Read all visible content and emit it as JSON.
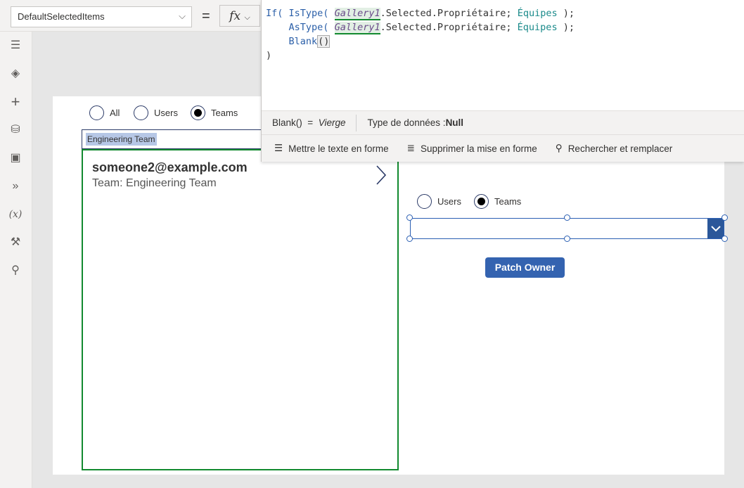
{
  "formula_bar": {
    "property": "DefaultSelectedItems",
    "equals": "=",
    "fx": "fx",
    "code": {
      "l1a": "If(",
      "l1b": "IsType(",
      "gallery": "Gallery1",
      "sel": ".Selected.Propriétaire;",
      "ent": "Équipes",
      "close": ");",
      "l2b": "AsType(",
      "l3": "Blank",
      "paren": "()",
      "l4": ")"
    },
    "status": {
      "expr": "Blank()",
      "eq": "=",
      "value": "Vierge",
      "type_label": "Type de données :",
      "type_value": "Null"
    },
    "tools": [
      "Mettre le texte en forme",
      "Supprimer la mise en forme",
      "Rechercher et remplacer"
    ]
  },
  "sidebar": [
    "menu-icon",
    "layers-icon",
    "insert-icon",
    "data-icon",
    "media-icon",
    "power-automate-icon",
    "variables-icon",
    "tools-icon",
    "search-icon"
  ],
  "canvas": {
    "radio1": [
      {
        "label": "All",
        "selected": false
      },
      {
        "label": "Users",
        "selected": false
      },
      {
        "label": "Teams",
        "selected": true
      }
    ],
    "combo_value": "Engineering Team",
    "gallery_item": {
      "email": "someone2@example.com",
      "team": "Team: Engineering Team"
    },
    "radio2": [
      {
        "label": "Users",
        "selected": false
      },
      {
        "label": "Teams",
        "selected": true
      }
    ],
    "dropdown_value": "",
    "patch_button": "Patch Owner"
  }
}
